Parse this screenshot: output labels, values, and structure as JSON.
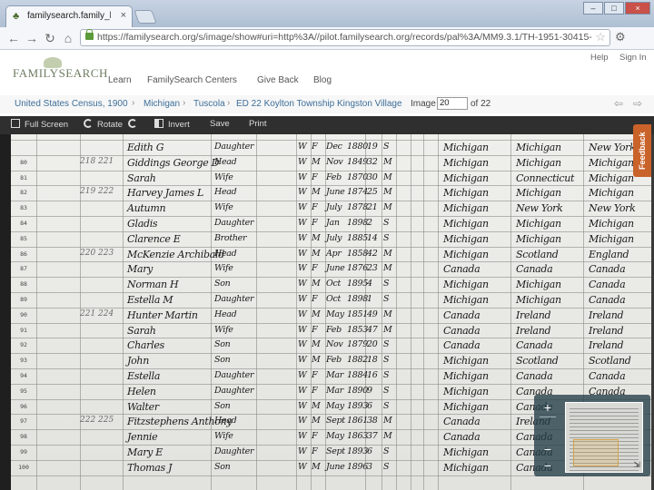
{
  "browser": {
    "tab_title": "familysearch.family_histo...",
    "tab_close": "×",
    "url": "https://familysearch.org/s/image/show#uri=http%3A//pilot.familysearch.org/records/pal%3A/MM9.3.1/TH-1951-30415-13229-87?cc=1325221&wc=MMBF-6D6:1031746111",
    "window_buttons": [
      "–",
      "□",
      "×"
    ],
    "nav": {
      "back": "←",
      "forward": "→",
      "reload": "↻",
      "home": "⌂"
    }
  },
  "site": {
    "logo_text": "FAMILYSEARCH",
    "nav_items": [
      "Learn",
      "FamilySearch Centers",
      "Give Back",
      "Blog"
    ],
    "util_items": [
      "Help",
      "Sign In"
    ]
  },
  "breadcrumb": {
    "items": [
      "United States Census, 1900",
      "Michigan",
      "Tuscola",
      "ED 22 Koylton Township Kingston Village"
    ],
    "image_label": "Image",
    "image_number": "20",
    "of_label": "of 22"
  },
  "viewer_toolbar": {
    "full_screen": "Full Screen",
    "rotate": "Rotate",
    "invert": "Invert",
    "save": "Save",
    "print": "Print"
  },
  "feedback_label": "Feedback",
  "census": {
    "row_numbers": [
      "80",
      "81",
      "82",
      "83",
      "84",
      "85",
      "86",
      "87",
      "88",
      "89",
      "90",
      "91",
      "92",
      "93",
      "94",
      "95",
      "96",
      "97",
      "98",
      "99",
      "100"
    ],
    "rows": [
      {
        "dwelling": "",
        "name": "Edith G",
        "relation": "Daughter",
        "color": "W",
        "sex": "F",
        "month": "Dec",
        "year": "1880",
        "age": "19",
        "marital": "S",
        "pob": "Michigan",
        "father_pob": "Michigan",
        "mother_pob": "New York"
      },
      {
        "dwelling": "218 221",
        "name": "Giddings George D",
        "relation": "Head",
        "color": "W",
        "sex": "M",
        "month": "Nov",
        "year": "1849",
        "age": "32",
        "marital": "M",
        "pob": "Michigan",
        "father_pob": "Michigan",
        "mother_pob": "Michigan"
      },
      {
        "dwelling": "",
        "name": "Sarah",
        "relation": "Wife",
        "color": "W",
        "sex": "F",
        "month": "Feb",
        "year": "1870",
        "age": "30",
        "marital": "M",
        "pob": "Michigan",
        "father_pob": "Connecticut",
        "mother_pob": "Michigan"
      },
      {
        "dwelling": "219 222",
        "name": "Harvey James L",
        "relation": "Head",
        "color": "W",
        "sex": "M",
        "month": "June",
        "year": "1874",
        "age": "25",
        "marital": "M",
        "pob": "Michigan",
        "father_pob": "Michigan",
        "mother_pob": "Michigan"
      },
      {
        "dwelling": "",
        "name": "Autumn",
        "relation": "Wife",
        "color": "W",
        "sex": "F",
        "month": "July",
        "year": "1878",
        "age": "21",
        "marital": "M",
        "pob": "Michigan",
        "father_pob": "New York",
        "mother_pob": "New York"
      },
      {
        "dwelling": "",
        "name": "Gladis",
        "relation": "Daughter",
        "color": "W",
        "sex": "F",
        "month": "Jan",
        "year": "1898",
        "age": "2",
        "marital": "S",
        "pob": "Michigan",
        "father_pob": "Michigan",
        "mother_pob": "Michigan"
      },
      {
        "dwelling": "",
        "name": "Clarence E",
        "relation": "Brother",
        "color": "W",
        "sex": "M",
        "month": "July",
        "year": "1885",
        "age": "14",
        "marital": "S",
        "pob": "Michigan",
        "father_pob": "Michigan",
        "mother_pob": "Michigan"
      },
      {
        "dwelling": "220 223",
        "name": "McKenzie Archibald",
        "relation": "Head",
        "color": "W",
        "sex": "M",
        "month": "Apr",
        "year": "1858",
        "age": "42",
        "marital": "M",
        "pob": "Michigan",
        "father_pob": "Scotland",
        "mother_pob": "England"
      },
      {
        "dwelling": "",
        "name": "Mary",
        "relation": "Wife",
        "color": "W",
        "sex": "F",
        "month": "June",
        "year": "1876",
        "age": "23",
        "marital": "M",
        "pob": "Canada",
        "father_pob": "Canada",
        "mother_pob": "Canada"
      },
      {
        "dwelling": "",
        "name": "Norman H",
        "relation": "Son",
        "color": "W",
        "sex": "M",
        "month": "Oct",
        "year": "1895",
        "age": "4",
        "marital": "S",
        "pob": "Michigan",
        "father_pob": "Michigan",
        "mother_pob": "Canada"
      },
      {
        "dwelling": "",
        "name": "Estella M",
        "relation": "Daughter",
        "color": "W",
        "sex": "F",
        "month": "Oct",
        "year": "1898",
        "age": "1",
        "marital": "S",
        "pob": "Michigan",
        "father_pob": "Michigan",
        "mother_pob": "Canada"
      },
      {
        "dwelling": "221 224",
        "name": "Hunter Martin",
        "relation": "Head",
        "color": "W",
        "sex": "M",
        "month": "May",
        "year": "1851",
        "age": "49",
        "marital": "M",
        "pob": "Canada",
        "father_pob": "Ireland",
        "mother_pob": "Ireland"
      },
      {
        "dwelling": "",
        "name": "Sarah",
        "relation": "Wife",
        "color": "W",
        "sex": "F",
        "month": "Feb",
        "year": "1853",
        "age": "47",
        "marital": "M",
        "pob": "Canada",
        "father_pob": "Ireland",
        "mother_pob": "Ireland"
      },
      {
        "dwelling": "",
        "name": "Charles",
        "relation": "Son",
        "color": "W",
        "sex": "M",
        "month": "Nov",
        "year": "1879",
        "age": "20",
        "marital": "S",
        "pob": "Canada",
        "father_pob": "Canada",
        "mother_pob": "Ireland"
      },
      {
        "dwelling": "",
        "name": "John",
        "relation": "Son",
        "color": "W",
        "sex": "M",
        "month": "Feb",
        "year": "1882",
        "age": "18",
        "marital": "S",
        "pob": "Michigan",
        "father_pob": "Scotland",
        "mother_pob": "Scotland"
      },
      {
        "dwelling": "",
        "name": "Estella",
        "relation": "Daughter",
        "color": "W",
        "sex": "F",
        "month": "Mar",
        "year": "1884",
        "age": "16",
        "marital": "S",
        "pob": "Michigan",
        "father_pob": "Canada",
        "mother_pob": "Canada"
      },
      {
        "dwelling": "",
        "name": "Helen",
        "relation": "Daughter",
        "color": "W",
        "sex": "F",
        "month": "Mar",
        "year": "1890",
        "age": "9",
        "marital": "S",
        "pob": "Michigan",
        "father_pob": "Canada",
        "mother_pob": "Canada"
      },
      {
        "dwelling": "",
        "name": "Walter",
        "relation": "Son",
        "color": "W",
        "sex": "M",
        "month": "May",
        "year": "1893",
        "age": "6",
        "marital": "S",
        "pob": "Michigan",
        "father_pob": "Canada",
        "mother_pob": "Canada"
      },
      {
        "dwelling": "222 225",
        "name": "Fitzstephens Anthony",
        "relation": "Head",
        "color": "W",
        "sex": "M",
        "month": "Sept",
        "year": "1861",
        "age": "38",
        "marital": "M",
        "pob": "Canada",
        "father_pob": "Ireland",
        "mother_pob": "Ireland"
      },
      {
        "dwelling": "",
        "name": "Jennie",
        "relation": "Wife",
        "color": "W",
        "sex": "F",
        "month": "May",
        "year": "1863",
        "age": "37",
        "marital": "M",
        "pob": "Canada",
        "father_pob": "Canada",
        "mother_pob": "Canada"
      },
      {
        "dwelling": "",
        "name": "Mary E",
        "relation": "Daughter",
        "color": "W",
        "sex": "F",
        "month": "Sept",
        "year": "1893",
        "age": "6",
        "marital": "S",
        "pob": "Michigan",
        "father_pob": "Canada",
        "mother_pob": "Canada"
      },
      {
        "dwelling": "",
        "name": "Thomas J",
        "relation": "Son",
        "color": "W",
        "sex": "M",
        "month": "June",
        "year": "1896",
        "age": "3",
        "marital": "S",
        "pob": "Michigan",
        "father_pob": "Canada",
        "mother_pob": "Canada"
      }
    ]
  },
  "zoom": {
    "in": "+",
    "out": "−",
    "out2": "−"
  }
}
